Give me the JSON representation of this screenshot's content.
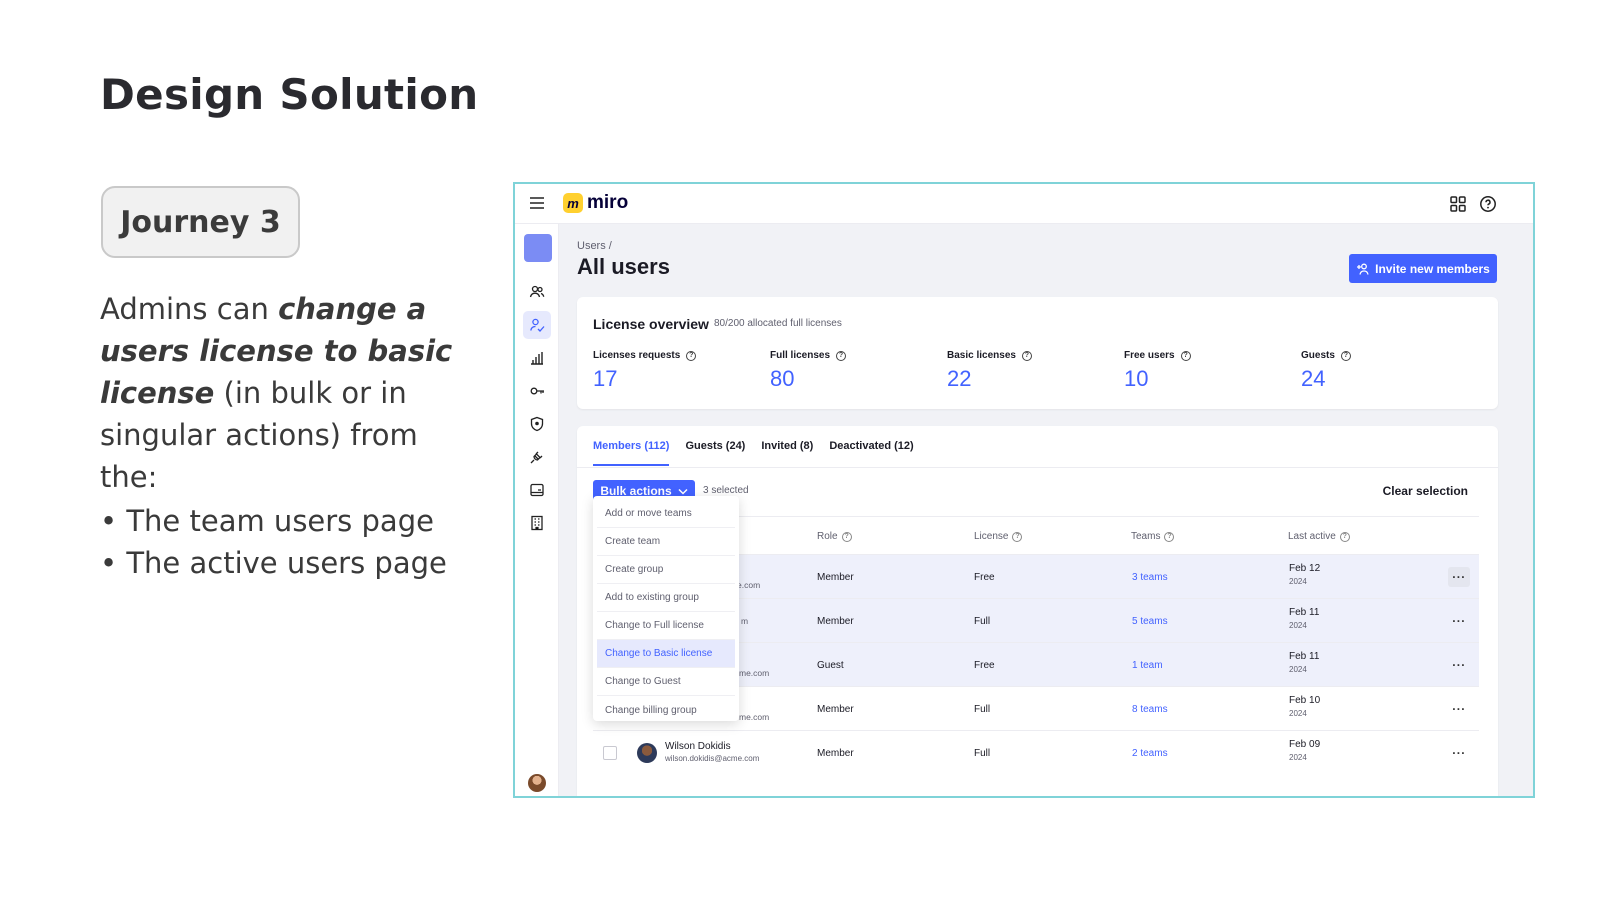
{
  "slide": {
    "title": "Design Solution",
    "journey": "Journey 3",
    "desc_plain_1": "Admins can ",
    "desc_em": "change a users license to basic license",
    "desc_plain_2": " (in bulk or in singular actions) from the:",
    "bullets": [
      "The team users page",
      "The active users page"
    ]
  },
  "app": {
    "logo": "miro",
    "logo_mark": "m",
    "breadcrumb": "Users /",
    "page_title": "All users",
    "invite_label": "Invite new members",
    "license_overview": {
      "title": "License overview",
      "subtitle": "80/200 allocated full licenses",
      "stats": [
        {
          "label": "Licenses requests",
          "value": "17"
        },
        {
          "label": "Full licenses",
          "value": "80"
        },
        {
          "label": "Basic licenses",
          "value": "22"
        },
        {
          "label": "Free users",
          "value": "10"
        },
        {
          "label": "Guests",
          "value": "24"
        }
      ]
    },
    "tabs": [
      "Members (112)",
      "Guests (24)",
      "Invited (8)",
      "Deactivated (12)"
    ],
    "bulk_label": "Bulk actions",
    "selected_text": "3 selected",
    "clear_label": "Clear selection",
    "columns": {
      "role": "Role",
      "license": "License",
      "teams": "Teams",
      "last_active": "Last active"
    },
    "rows": [
      {
        "email_frag": "e.com",
        "role": "Member",
        "license": "Free",
        "teams": "3 teams",
        "date": "Feb 12",
        "year": "2024",
        "more": "···"
      },
      {
        "email_frag": "m",
        "role": "Member",
        "license": "Full",
        "teams": "5 teams",
        "date": "Feb 11",
        "year": "2024",
        "more": "···"
      },
      {
        "email_frag": "me.com",
        "role": "Guest",
        "license": "Free",
        "teams": "1 team",
        "date": "Feb 11",
        "year": "2024",
        "more": "···"
      },
      {
        "email_frag": "me.com",
        "role": "Member",
        "license": "Full",
        "teams": "8 teams",
        "date": "Feb 10",
        "year": "2024",
        "more": "···"
      },
      {
        "name": "Wilson Dokidis",
        "email": "wilson.dokidis@acme.com",
        "role": "Member",
        "license": "Full",
        "teams": "2 teams",
        "date": "Feb 09",
        "year": "2024",
        "more": "···"
      }
    ],
    "dropdown": [
      "Add or move teams",
      "Create team",
      "Create group",
      "Add to existing group",
      "Change to Full license",
      "Change to Basic license",
      "Change to Guest",
      "Change billing group"
    ]
  }
}
